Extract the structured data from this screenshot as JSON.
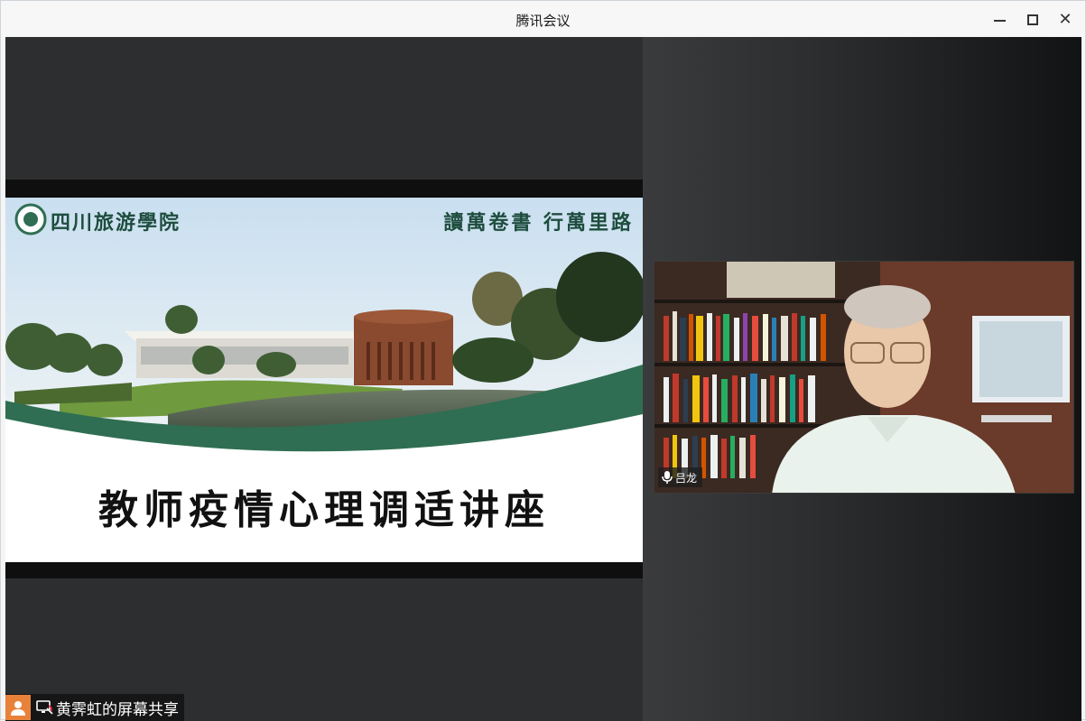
{
  "window": {
    "title": "腾讯会议"
  },
  "slide": {
    "school_name": "四川旅游學院",
    "motto": "讀萬卷書 行萬里路",
    "lecture_title": "教师疫情心理调适讲座"
  },
  "video": {
    "speaker_name": "吕龙"
  },
  "screen_share": {
    "label": "黄霁虹的屏幕共享"
  },
  "colors": {
    "brand_green": "#1e4d3e",
    "avatar_orange": "#e8823a"
  }
}
